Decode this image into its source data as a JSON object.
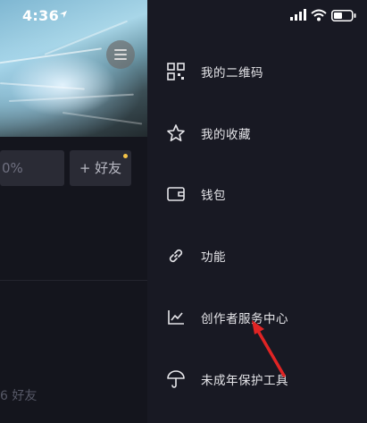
{
  "status_bar": {
    "time": "4:36"
  },
  "left_panel": {
    "chip_stat": "0%",
    "add_friend_label": "+ 好友",
    "friends_label": "6 好友"
  },
  "drawer": {
    "items": [
      {
        "label": "我的二维码",
        "icon": "qr-code-icon"
      },
      {
        "label": "我的收藏",
        "icon": "star-icon"
      },
      {
        "label": "钱包",
        "icon": "wallet-icon"
      },
      {
        "label": "功能",
        "icon": "link-icon"
      },
      {
        "label": "创作者服务中心",
        "icon": "trend-chart-icon"
      },
      {
        "label": "未成年保护工具",
        "icon": "umbrella-icon"
      }
    ]
  },
  "colors": {
    "background": "#181923",
    "accent_dot": "#f5c347",
    "annotation_arrow": "#e02424"
  }
}
